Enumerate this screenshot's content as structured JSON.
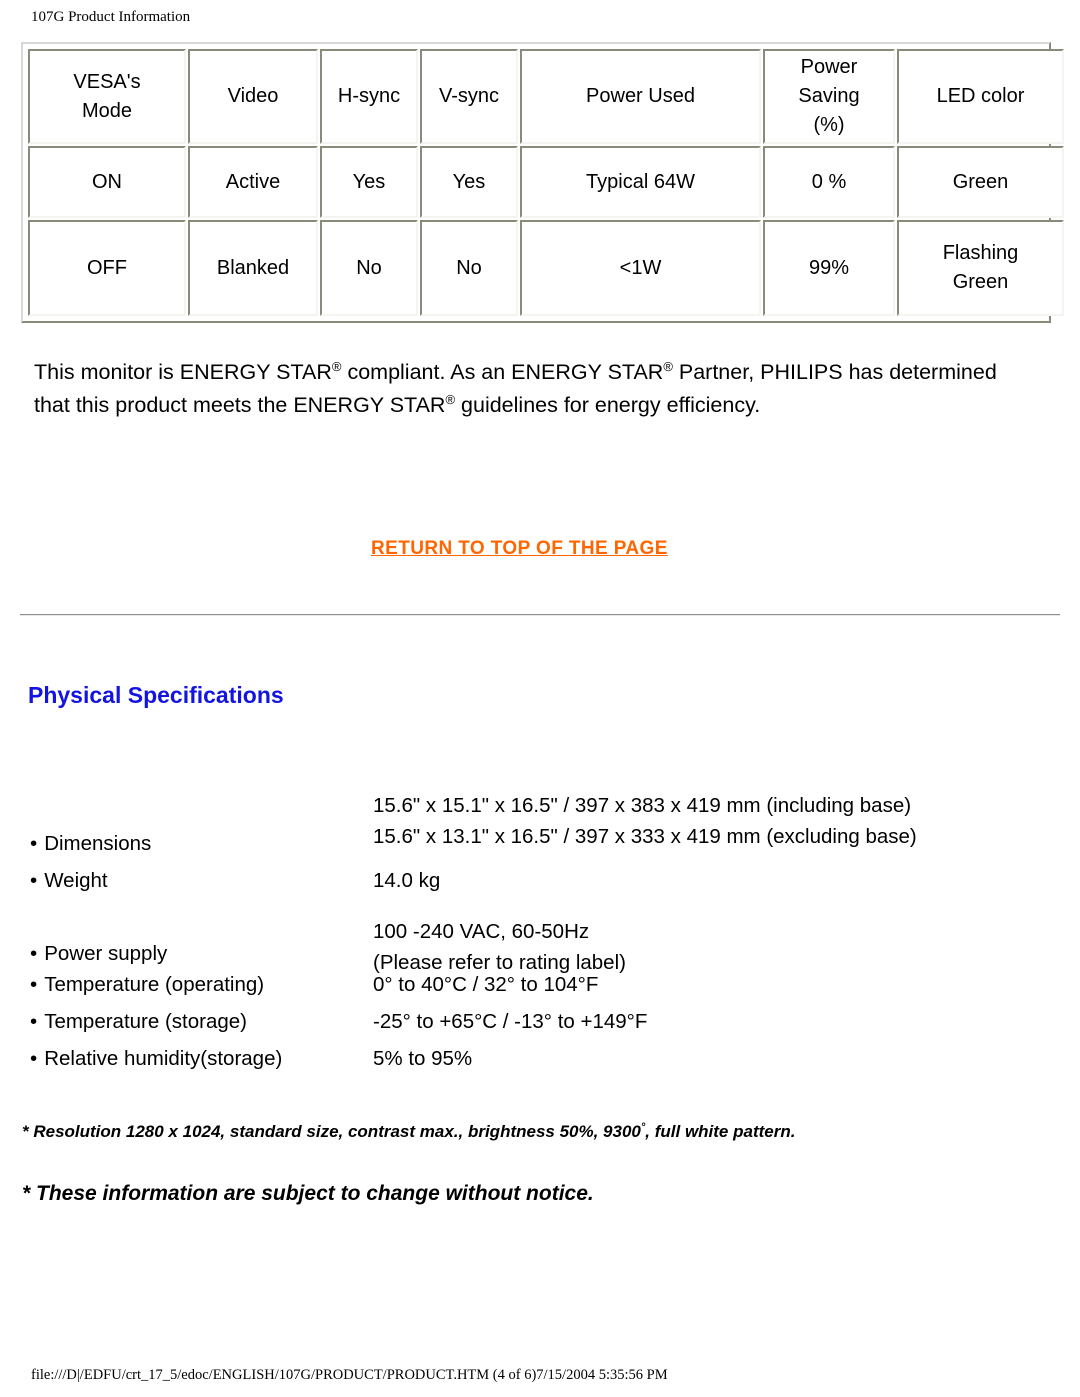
{
  "header": {
    "title": "107G Product Information"
  },
  "power_table": {
    "columns": [
      "VESA's\nMode",
      "Video",
      "H-sync",
      "V-sync",
      "Power Used",
      "Power\nSaving\n(%)",
      "LED color"
    ],
    "rows": [
      {
        "mode": "ON",
        "video": "Active",
        "hsync": "Yes",
        "vsync": "Yes",
        "power_used": "Typical 64W",
        "power_saving": "0 %",
        "led_color": "Green"
      },
      {
        "mode": "OFF",
        "video": "Blanked",
        "hsync": "No",
        "vsync": "No",
        "power_used": "<1W",
        "power_saving": "99%",
        "led_color": "Flashing\nGreen"
      }
    ]
  },
  "energy_star": {
    "part1": "This monitor is ENERGY STAR",
    "mark": "®",
    "part2": " compliant. As an ENERGY STAR",
    "part3": " Partner, PHILIPS has determined that this product meets the ENERGY STAR",
    "part4": " guidelines for energy efficiency."
  },
  "links": {
    "return_to_top": "RETURN TO TOP OF THE PAGE",
    "return_to_top_color": "#ff6600"
  },
  "physical_specifications": {
    "heading": "Physical Specifications",
    "heading_color": "#1414e0",
    "items": [
      {
        "label": "Dimensions",
        "value": "15.6\" x 15.1\" x 16.5\" / 397 x 383 x 419 mm (including base)\n15.6\" x 13.1\" x 16.5\" / 397 x 333 x 419 mm (excluding base)"
      },
      {
        "label": "Weight",
        "value": "14.0 kg"
      },
      {
        "label": "Power supply",
        "value": "100 -240 VAC, 60-50Hz\n(Please refer to rating label)"
      },
      {
        "label": "Temperature (operating)",
        "value": "0° to 40°C / 32° to 104°F"
      },
      {
        "label": "Temperature (storage)",
        "value": "-25° to +65°C / -13° to +149°F"
      },
      {
        "label": "Relative humidity(storage)",
        "value": "5% to 95%"
      }
    ]
  },
  "footnotes": {
    "note1_before": "* Resolution 1280 x 1024, standard size, contrast max., brightness 50%, 9300",
    "note1_degree": "°",
    "note1_after": ", full white pattern.",
    "note2": "*  These information are subject to change without notice."
  },
  "footer": {
    "path": "file:///D|/EDFU/crt_17_5/edoc/ENGLISH/107G/PRODUCT/PRODUCT.HTM (4 of 6)7/15/2004 5:35:56 PM"
  }
}
